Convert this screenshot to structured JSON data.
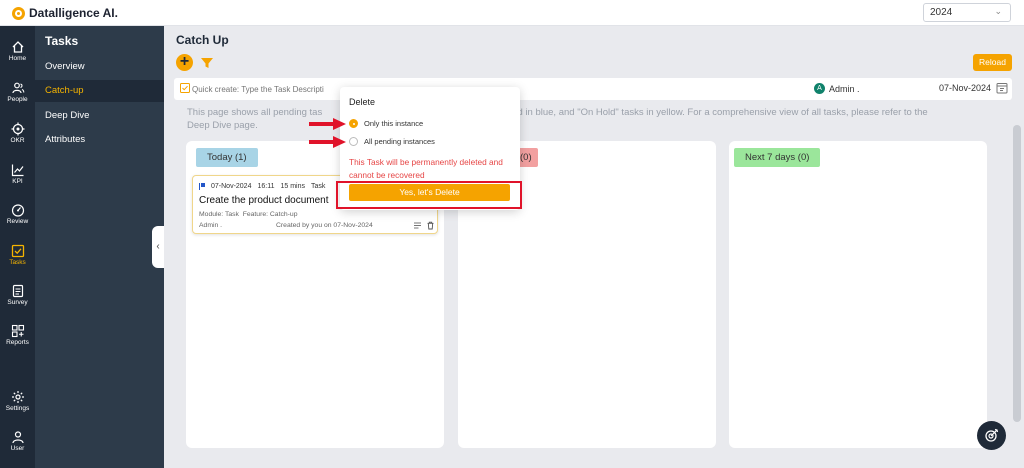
{
  "app": {
    "brand": "Datalligence AI.",
    "year_select": "2024"
  },
  "iconbar": {
    "items": [
      {
        "label": "Home",
        "icon": "home-icon"
      },
      {
        "label": "People",
        "icon": "people-icon"
      },
      {
        "label": "OKR",
        "icon": "target-icon"
      },
      {
        "label": "KPI",
        "icon": "chart-line-icon"
      },
      {
        "label": "Review",
        "icon": "gauge-icon"
      },
      {
        "label": "Tasks",
        "icon": "checkbox-icon"
      },
      {
        "label": "Survey",
        "icon": "clipboard-icon"
      },
      {
        "label": "Reports",
        "icon": "grid-plus-icon"
      },
      {
        "label": "Settings",
        "icon": "gear-icon"
      },
      {
        "label": "User",
        "icon": "user-icon"
      }
    ]
  },
  "subnav": {
    "title": "Tasks",
    "items": [
      "Overview",
      "Catch-up",
      "Deep Dive",
      "Attributes"
    ]
  },
  "main": {
    "title": "Catch Up",
    "reload": "Reload",
    "quick_create_placeholder": "Quick create: Type the Task Descripti",
    "owner_initial": "A",
    "owner": "Admin .",
    "date": "07-Nov-2024",
    "info_line1": "This page shows all pending tas                                                                          d in blue, and \"On Hold\" tasks in yellow. For a comprehensive view of all tasks, please refer to the",
    "info_line2": "Deep Dive page."
  },
  "columns": [
    {
      "label": "Today (1)",
      "color": "#a8d4e6"
    },
    {
      "label": "(0)",
      "color": "#f2a0a0"
    },
    {
      "label": "Next 7 days (0)",
      "color": "#9be69b"
    }
  ],
  "task": {
    "date": "07-Nov-2024",
    "time": "16:11",
    "duration": "15 mins",
    "type": "Task",
    "title": "Create the product document",
    "module": "Module: Task",
    "feature": "Feature: Catch-up",
    "assignee": "Admin .",
    "created": "Created by you on 07-Nov-2024"
  },
  "popover": {
    "title": "Delete",
    "option1": "Only this instance",
    "option2": "All pending instances",
    "warning": "This Task will be permanently deleted and cannot be recovered",
    "confirm": "Yes, let's Delete"
  },
  "colors": {
    "accent": "#f5a300",
    "sidebar": "#1f2a38",
    "subnav": "#2d3b4a",
    "danger": "#e0132a"
  }
}
